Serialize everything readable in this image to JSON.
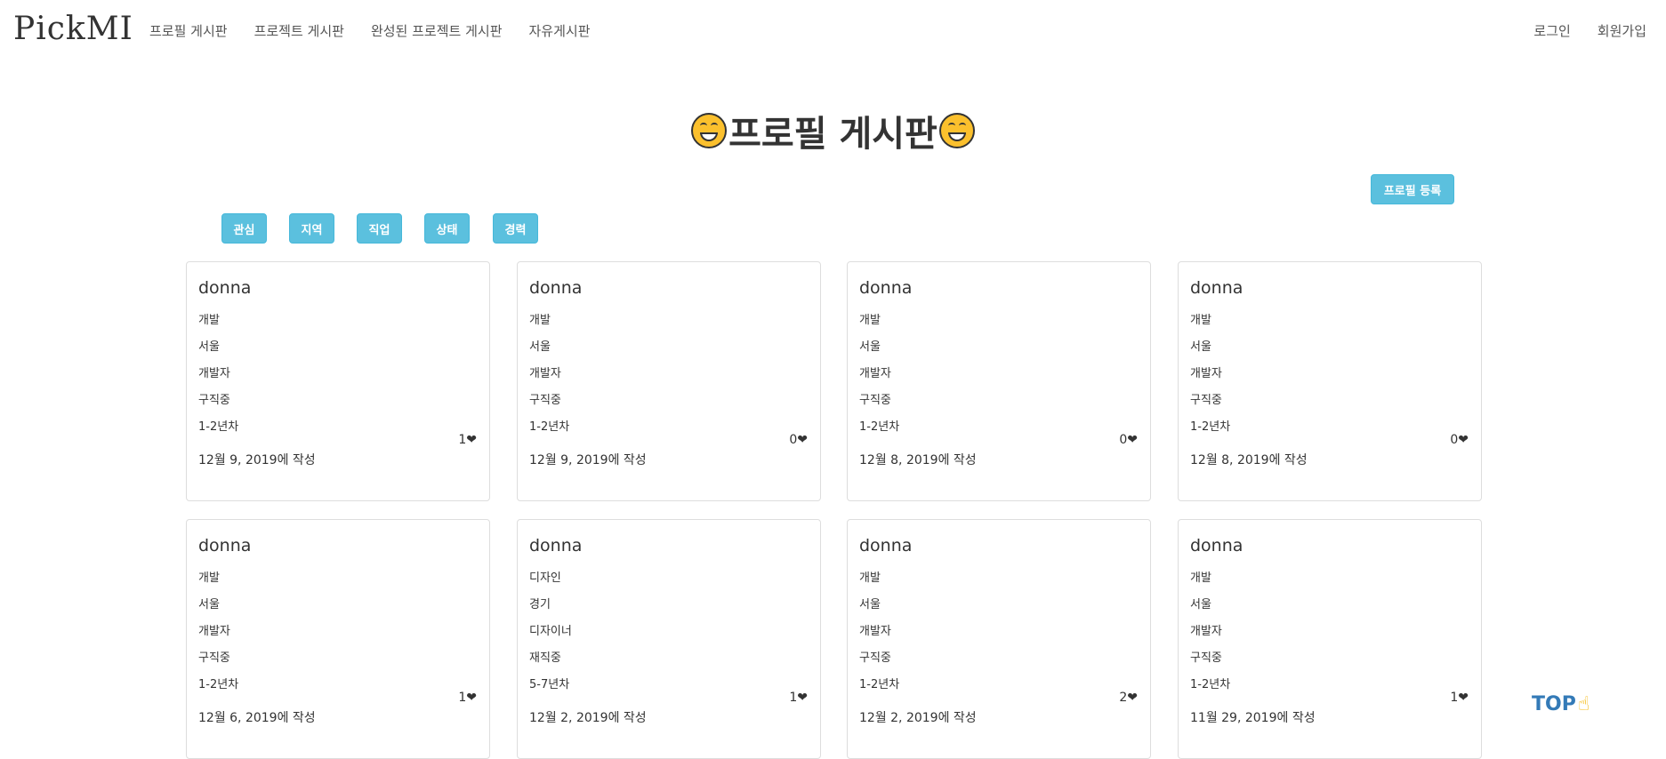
{
  "navbar": {
    "logo": "PickMI",
    "left_links": [
      "프로필 게시판",
      "프로젝트 게시판",
      "완성된 프로젝트 게시판",
      "자유게시판"
    ],
    "right_links": [
      "로그인",
      "회원가입"
    ]
  },
  "page": {
    "title": "프로필 게시판",
    "register_button": "프로필 등록",
    "filters": [
      "관심",
      "지역",
      "직업",
      "상태",
      "경력"
    ],
    "top_link": "TOP"
  },
  "cards": [
    {
      "name": "donna",
      "interest": "개발",
      "region": "서울",
      "job": "개발자",
      "status": "구직중",
      "career": "1-2년차",
      "likes": "1",
      "date": "12월 9, 2019에 작성"
    },
    {
      "name": "donna",
      "interest": "개발",
      "region": "서울",
      "job": "개발자",
      "status": "구직중",
      "career": "1-2년차",
      "likes": "0",
      "date": "12월 9, 2019에 작성"
    },
    {
      "name": "donna",
      "interest": "개발",
      "region": "서울",
      "job": "개발자",
      "status": "구직중",
      "career": "1-2년차",
      "likes": "0",
      "date": "12월 8, 2019에 작성"
    },
    {
      "name": "donna",
      "interest": "개발",
      "region": "서울",
      "job": "개발자",
      "status": "구직중",
      "career": "1-2년차",
      "likes": "0",
      "date": "12월 8, 2019에 작성"
    },
    {
      "name": "donna",
      "interest": "개발",
      "region": "서울",
      "job": "개발자",
      "status": "구직중",
      "career": "1-2년차",
      "likes": "1",
      "date": "12월 6, 2019에 작성"
    },
    {
      "name": "donna",
      "interest": "디자인",
      "region": "경기",
      "job": "디자이너",
      "status": "재직중",
      "career": "5-7년차",
      "likes": "1",
      "date": "12월 2, 2019에 작성"
    },
    {
      "name": "donna",
      "interest": "개발",
      "region": "서울",
      "job": "개발자",
      "status": "구직중",
      "career": "1-2년차",
      "likes": "2",
      "date": "12월 2, 2019에 작성"
    },
    {
      "name": "donna",
      "interest": "개발",
      "region": "서울",
      "job": "개발자",
      "status": "구직중",
      "career": "1-2년차",
      "likes": "1",
      "date": "11월 29, 2019에 작성"
    }
  ]
}
